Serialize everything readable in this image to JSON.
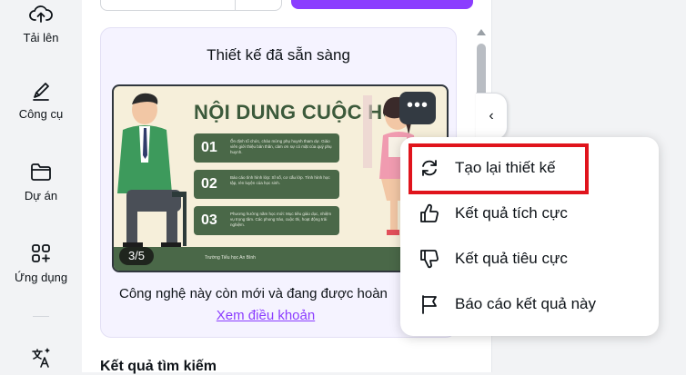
{
  "rail": {
    "items": [
      {
        "label": "Tải lên",
        "icon": "cloud-upload-icon"
      },
      {
        "label": "Công cụ",
        "icon": "pen-tool-icon"
      },
      {
        "label": "Dự án",
        "icon": "folder-icon"
      },
      {
        "label": "Ứng dụng",
        "icon": "apps-grid-icon"
      },
      {
        "label": "",
        "icon": "translate-icon"
      }
    ]
  },
  "card": {
    "title": "Thiết kế đã sẵn sàng",
    "design": {
      "heading": "NỘI DUNG CUỘC HỌP",
      "rows": [
        {
          "num": "01",
          "text": "Ổn định tổ chức, chào mừng phụ huynh tham dự. Giáo viên giới thiệu bản thân, cảm ơn sự có mặt của quý phụ huynh."
        },
        {
          "num": "02",
          "text": "Báo cáo tình hình lớp: Sĩ số, cơ cấu lớp. Tình hình học tập, rèn luyện của học sinh."
        },
        {
          "num": "03",
          "text": "Phương hướng năm học mới: Mục tiêu giáo dục, nhiệm vụ trọng tâm. Các phong trào, cuộc thi, hoạt động trải nghiệm."
        }
      ],
      "school": "Trường Tiểu học An Bình"
    },
    "page_badge": "3/5",
    "more_label": "•••",
    "description": "Công nghệ này còn mới và đang được hoàn",
    "terms_link": "Xem điều khoản"
  },
  "results_title": "Kết quả tìm kiếm",
  "collapse_label": "‹",
  "menu": {
    "items": [
      {
        "label": "Tạo lại thiết kế",
        "icon": "regenerate-icon"
      },
      {
        "label": "Kết quả tích cực",
        "icon": "thumbs-up-icon"
      },
      {
        "label": "Kết quả tiêu cực",
        "icon": "thumbs-down-icon"
      },
      {
        "label": "Báo cáo kết quả này",
        "icon": "flag-icon"
      }
    ]
  },
  "colors": {
    "accent": "#8b3dff",
    "highlight": "#e0141c",
    "design_green": "#4a6848"
  }
}
